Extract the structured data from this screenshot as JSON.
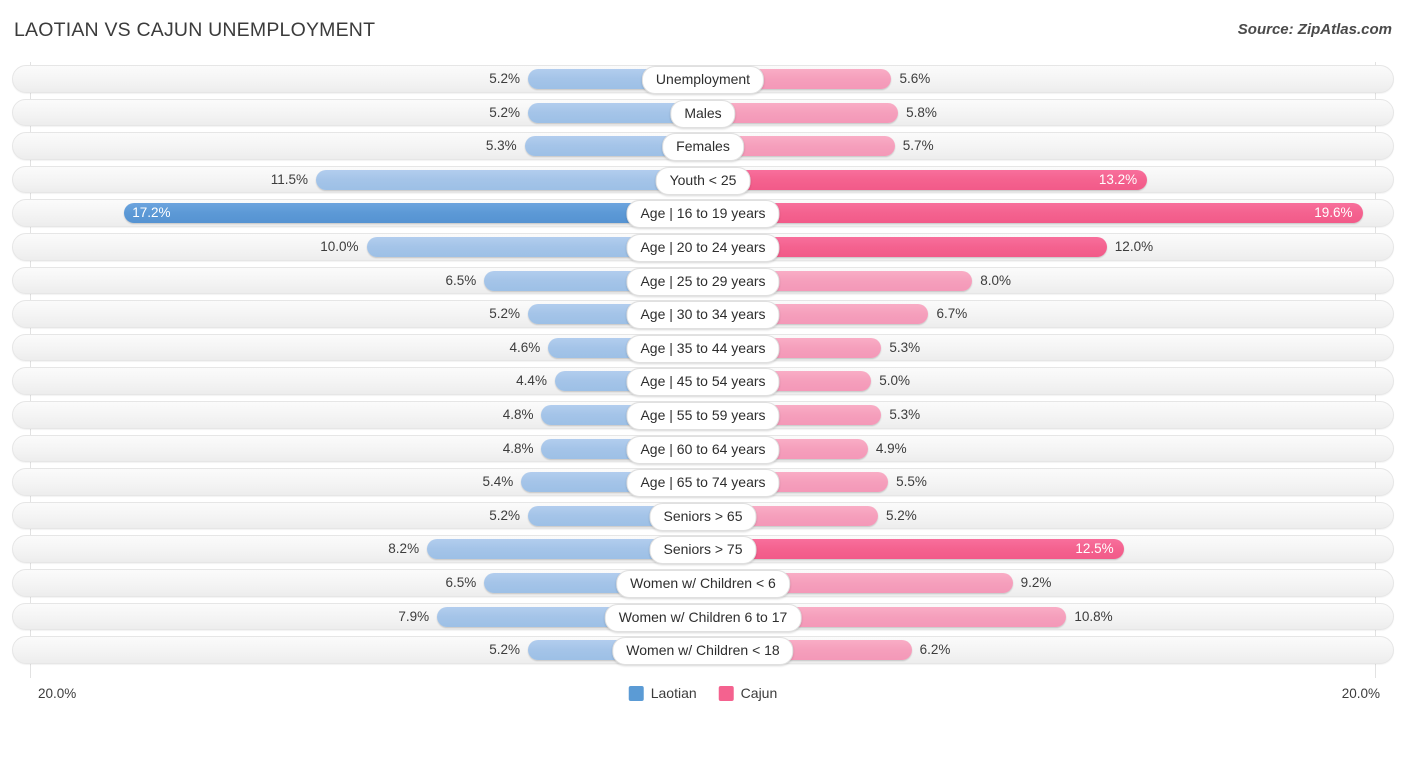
{
  "header": {
    "title": "LAOTIAN VS CAJUN UNEMPLOYMENT",
    "source": "Source: ZipAtlas.com"
  },
  "axis": {
    "left_max": "20.0%",
    "right_max": "20.0%"
  },
  "legend": {
    "items": [
      {
        "label": "Laotian",
        "color": "#5b9bd5",
        "icon": "legend-swatch-laotian"
      },
      {
        "label": "Cajun",
        "color": "#f4628f",
        "icon": "legend-swatch-cajun"
      }
    ]
  },
  "chart_data": {
    "type": "bar",
    "title": "LAOTIAN VS CAJUN UNEMPLOYMENT",
    "subtitle": "",
    "orientation": "horizontal-diverging",
    "xlabel": "",
    "ylabel": "",
    "xlim": [
      -20.0,
      20.0
    ],
    "axis_max": 20.0,
    "unit": "%",
    "grid": false,
    "legend_position": "bottom-center",
    "categories": [
      "Unemployment",
      "Males",
      "Females",
      "Youth < 25",
      "Age | 16 to 19 years",
      "Age | 20 to 24 years",
      "Age | 25 to 29 years",
      "Age | 30 to 34 years",
      "Age | 35 to 44 years",
      "Age | 45 to 54 years",
      "Age | 55 to 59 years",
      "Age | 60 to 64 years",
      "Age | 65 to 74 years",
      "Seniors > 65",
      "Seniors > 75",
      "Women w/ Children < 6",
      "Women w/ Children 6 to 17",
      "Women w/ Children < 18"
    ],
    "series": [
      {
        "name": "Laotian",
        "color": "#a4c4e8",
        "highlight_color": "#5b9bd5",
        "side": "left",
        "values": [
          5.2,
          5.2,
          5.3,
          11.5,
          17.2,
          10.0,
          6.5,
          5.2,
          4.6,
          4.4,
          4.8,
          4.8,
          5.4,
          5.2,
          8.2,
          6.5,
          7.9,
          5.2
        ],
        "labels": [
          "5.2%",
          "5.2%",
          "5.3%",
          "11.5%",
          "17.2%",
          "10.0%",
          "6.5%",
          "5.2%",
          "4.6%",
          "4.4%",
          "4.8%",
          "4.8%",
          "5.4%",
          "5.2%",
          "8.2%",
          "6.5%",
          "7.9%",
          "5.2%"
        ]
      },
      {
        "name": "Cajun",
        "color": "#f59fbc",
        "highlight_color": "#f4628f",
        "side": "right",
        "values": [
          5.6,
          5.8,
          5.7,
          13.2,
          19.6,
          12.0,
          8.0,
          6.7,
          5.3,
          5.0,
          5.3,
          4.9,
          5.5,
          5.2,
          12.5,
          9.2,
          10.8,
          6.2
        ],
        "labels": [
          "5.6%",
          "5.8%",
          "5.7%",
          "13.2%",
          "19.6%",
          "12.0%",
          "8.0%",
          "6.7%",
          "5.3%",
          "5.0%",
          "5.3%",
          "4.9%",
          "5.5%",
          "5.2%",
          "12.5%",
          "9.2%",
          "10.8%",
          "6.2%"
        ]
      }
    ]
  },
  "rows": [
    {
      "category": "Unemployment",
      "left": 5.2,
      "left_label": "5.2%",
      "left_hi": false,
      "left_inside": false,
      "right": 5.6,
      "right_label": "5.6%",
      "right_hi": false,
      "right_inside": false
    },
    {
      "category": "Males",
      "left": 5.2,
      "left_label": "5.2%",
      "left_hi": false,
      "left_inside": false,
      "right": 5.8,
      "right_label": "5.8%",
      "right_hi": false,
      "right_inside": false
    },
    {
      "category": "Females",
      "left": 5.3,
      "left_label": "5.3%",
      "left_hi": false,
      "left_inside": false,
      "right": 5.7,
      "right_label": "5.7%",
      "right_hi": false,
      "right_inside": false
    },
    {
      "category": "Youth < 25",
      "left": 11.5,
      "left_label": "11.5%",
      "left_hi": false,
      "left_inside": false,
      "right": 13.2,
      "right_label": "13.2%",
      "right_hi": true,
      "right_inside": true
    },
    {
      "category": "Age | 16 to 19 years",
      "left": 17.2,
      "left_label": "17.2%",
      "left_hi": true,
      "left_inside": true,
      "right": 19.6,
      "right_label": "19.6%",
      "right_hi": true,
      "right_inside": true
    },
    {
      "category": "Age | 20 to 24 years",
      "left": 10.0,
      "left_label": "10.0%",
      "left_hi": false,
      "left_inside": false,
      "right": 12.0,
      "right_label": "12.0%",
      "right_hi": true,
      "right_inside": false
    },
    {
      "category": "Age | 25 to 29 years",
      "left": 6.5,
      "left_label": "6.5%",
      "left_hi": false,
      "left_inside": false,
      "right": 8.0,
      "right_label": "8.0%",
      "right_hi": false,
      "right_inside": false
    },
    {
      "category": "Age | 30 to 34 years",
      "left": 5.2,
      "left_label": "5.2%",
      "left_hi": false,
      "left_inside": false,
      "right": 6.7,
      "right_label": "6.7%",
      "right_hi": false,
      "right_inside": false
    },
    {
      "category": "Age | 35 to 44 years",
      "left": 4.6,
      "left_label": "4.6%",
      "left_hi": false,
      "left_inside": false,
      "right": 5.3,
      "right_label": "5.3%",
      "right_hi": false,
      "right_inside": false
    },
    {
      "category": "Age | 45 to 54 years",
      "left": 4.4,
      "left_label": "4.4%",
      "left_hi": false,
      "left_inside": false,
      "right": 5.0,
      "right_label": "5.0%",
      "right_hi": false,
      "right_inside": false
    },
    {
      "category": "Age | 55 to 59 years",
      "left": 4.8,
      "left_label": "4.8%",
      "left_hi": false,
      "left_inside": false,
      "right": 5.3,
      "right_label": "5.3%",
      "right_hi": false,
      "right_inside": false
    },
    {
      "category": "Age | 60 to 64 years",
      "left": 4.8,
      "left_label": "4.8%",
      "left_hi": false,
      "left_inside": false,
      "right": 4.9,
      "right_label": "4.9%",
      "right_hi": false,
      "right_inside": false
    },
    {
      "category": "Age | 65 to 74 years",
      "left": 5.4,
      "left_label": "5.4%",
      "left_hi": false,
      "left_inside": false,
      "right": 5.5,
      "right_label": "5.5%",
      "right_hi": false,
      "right_inside": false
    },
    {
      "category": "Seniors > 65",
      "left": 5.2,
      "left_label": "5.2%",
      "left_hi": false,
      "left_inside": false,
      "right": 5.2,
      "right_label": "5.2%",
      "right_hi": false,
      "right_inside": false
    },
    {
      "category": "Seniors > 75",
      "left": 8.2,
      "left_label": "8.2%",
      "left_hi": false,
      "left_inside": false,
      "right": 12.5,
      "right_label": "12.5%",
      "right_hi": true,
      "right_inside": true
    },
    {
      "category": "Women w/ Children < 6",
      "left": 6.5,
      "left_label": "6.5%",
      "left_hi": false,
      "left_inside": false,
      "right": 9.2,
      "right_label": "9.2%",
      "right_hi": false,
      "right_inside": false
    },
    {
      "category": "Women w/ Children 6 to 17",
      "left": 7.9,
      "left_label": "7.9%",
      "left_hi": false,
      "left_inside": false,
      "right": 10.8,
      "right_label": "10.8%",
      "right_hi": false,
      "right_inside": false
    },
    {
      "category": "Women w/ Children < 18",
      "left": 5.2,
      "left_label": "5.2%",
      "left_hi": false,
      "left_inside": false,
      "right": 6.2,
      "right_label": "6.2%",
      "right_hi": false,
      "right_inside": false
    }
  ]
}
